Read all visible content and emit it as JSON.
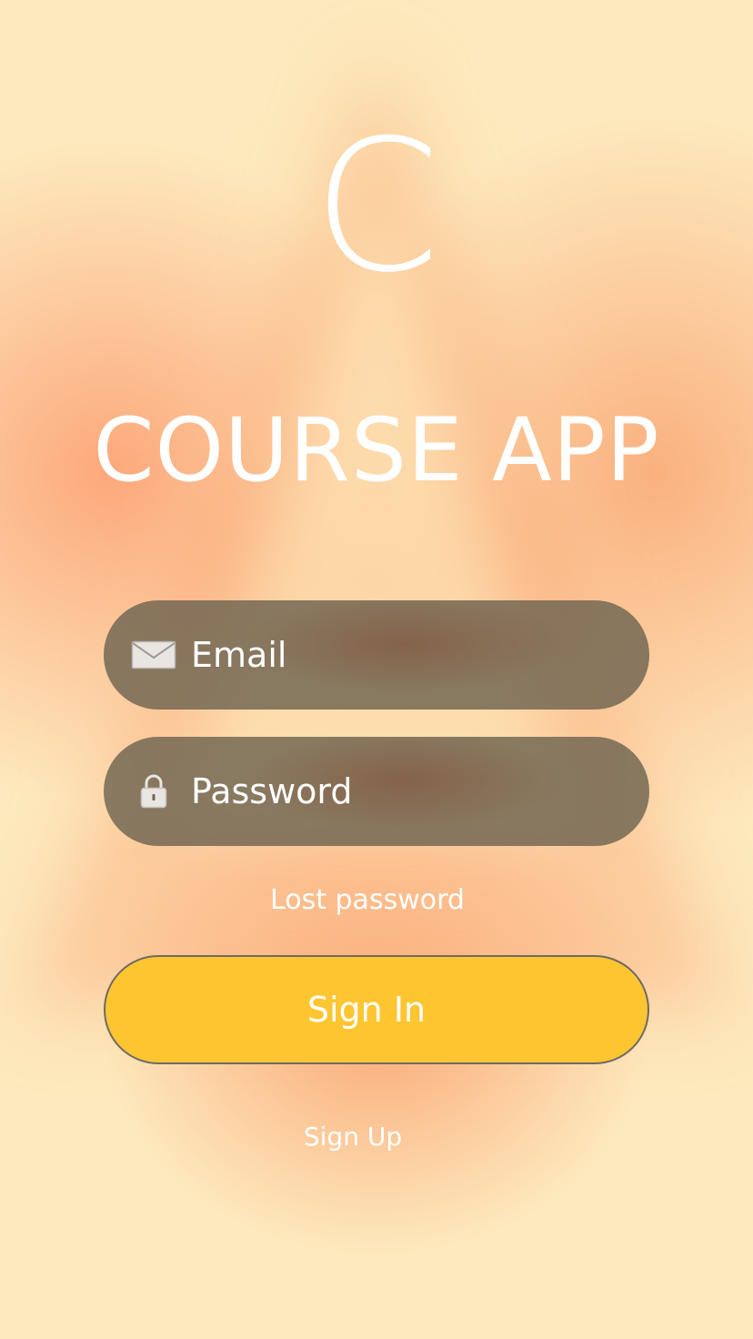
{
  "logo": {
    "letter": "C"
  },
  "app": {
    "title": "COURSE APP"
  },
  "form": {
    "email": {
      "placeholder": "Email",
      "icon": "mail-icon"
    },
    "password": {
      "placeholder": "Password",
      "icon": "lock-icon"
    },
    "lost_password": "Lost password",
    "sign_in": "Sign In",
    "sign_up": "Sign Up"
  },
  "colors": {
    "background_light": "#fde9bd",
    "background_warm": "#fca578",
    "field_bg": "#6e6450",
    "button_bg": "#fdc530",
    "button_border": "#6e6a66",
    "text": "#ffffff"
  }
}
